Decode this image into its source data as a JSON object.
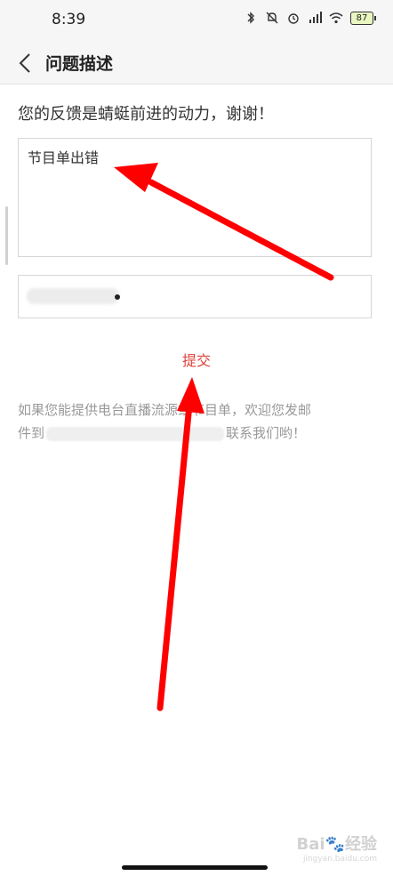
{
  "status_bar": {
    "time": "8:39",
    "battery": "87",
    "icons": [
      "bluetooth-icon",
      "mute-bell-icon",
      "alarm-icon",
      "signal-icon",
      "wifi-icon",
      "battery-icon"
    ]
  },
  "header": {
    "title": "问题描述",
    "back_icon": "chevron-left-icon"
  },
  "form": {
    "intro": "您的反馈是蜻蜓前进的动力，谢谢！",
    "description_value": "节目单出错",
    "submit_label": "提交"
  },
  "footer": {
    "line1": "如果您能提供电台直播流",
    "obscured_end": "源或节目单，欢迎您发邮",
    "line2_prefix": "件到",
    "line2_suffix": "联系我们哟！"
  },
  "colors": {
    "accent": "#e0403a",
    "annotation_arrow": "#ff0000",
    "header_bg": "#f6f6f6"
  },
  "watermark": {
    "brand": "Bai",
    "brand_suffix": "经验",
    "url": "jingyan.baidu.com"
  }
}
